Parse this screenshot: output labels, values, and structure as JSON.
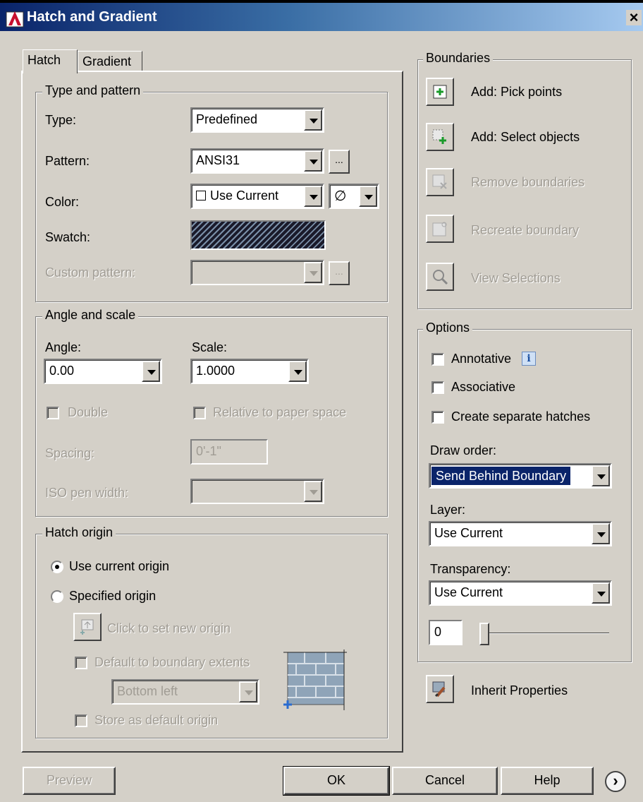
{
  "window": {
    "title": "Hatch and Gradient",
    "close": "×"
  },
  "tabs": [
    {
      "label": "Hatch"
    },
    {
      "label": "Gradient"
    }
  ],
  "type_pattern": {
    "title": "Type and pattern",
    "type_label": "Type:",
    "type_value": "Predefined",
    "pattern_label": "Pattern:",
    "pattern_value": "ANSI31",
    "color_label": "Color:",
    "color_value": "Use Current",
    "bgcolor_value": "∅",
    "swatch_label": "Swatch:",
    "custom_label": "Custom pattern:",
    "ellipsis": "..."
  },
  "angle_scale": {
    "title": "Angle and scale",
    "angle_label": "Angle:",
    "angle_value": "0.00",
    "scale_label": "Scale:",
    "scale_value": "1.0000",
    "double_label": "Double",
    "relative_label": "Relative to paper space",
    "spacing_label": "Spacing:",
    "spacing_value": "0'-1\"",
    "iso_label": "ISO pen width:"
  },
  "hatch_origin": {
    "title": "Hatch origin",
    "use_current_label": "Use current origin",
    "specified_label": "Specified origin",
    "click_set_label": "Click to set new origin",
    "default_extents_label": "Default to boundary extents",
    "position_value": "Bottom left",
    "store_default_label": "Store as default origin"
  },
  "boundaries": {
    "title": "Boundaries",
    "add_pick": "Add: Pick points",
    "add_select": "Add: Select objects",
    "remove": "Remove boundaries",
    "recreate": "Recreate boundary",
    "view": "View Selections"
  },
  "options": {
    "title": "Options",
    "annotative_label": "Annotative",
    "info_glyph": "i",
    "associative_label": "Associative",
    "separate_label": "Create separate hatches",
    "draw_order_label": "Draw order:",
    "draw_order_value": "Send Behind Boundary",
    "layer_label": "Layer:",
    "layer_value": "Use Current",
    "transparency_label": "Transparency:",
    "transparency_value": "Use Current",
    "transparency_number": "0",
    "transparency_level": 0
  },
  "inherit_label": "Inherit Properties",
  "footer": {
    "preview": "Preview",
    "ok": "OK",
    "cancel": "Cancel",
    "help": "Help",
    "more": "›"
  },
  "colors": {
    "titlebar_start": "#0a246a",
    "titlebar_end": "#a6caf0",
    "dialog_bg": "#d4d0c8",
    "selection": "#0a246a"
  }
}
